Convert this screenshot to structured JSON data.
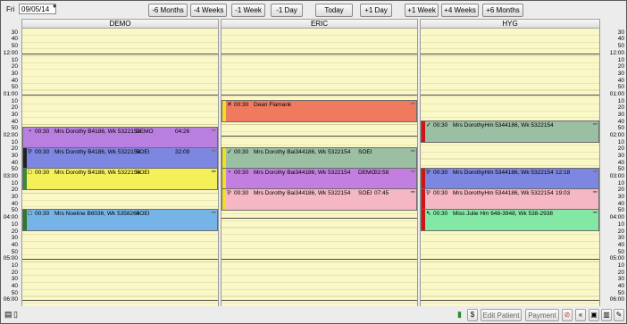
{
  "toolbar": {
    "day": "Fri",
    "date": "09/05/14",
    "buttons": [
      "-6 Months",
      "-4 Weeks",
      "-1 Week",
      "-1 Day",
      "Today",
      "+1 Day",
      "+1 Week",
      "+4 Weeks",
      "+6 Months"
    ]
  },
  "columns": [
    "DEMO",
    "ERIC",
    "HYG"
  ],
  "time_labels": [
    "30",
    "40",
    "50",
    "12:00",
    "10",
    "20",
    "30",
    "40",
    "50",
    "01:00",
    "10",
    "20",
    "30",
    "40",
    "50",
    "02:00",
    "10",
    "20",
    "30",
    "40",
    "50",
    "03:00",
    "10",
    "20",
    "30",
    "40",
    "50",
    "04:00",
    "10",
    "20",
    "30",
    "40",
    "50",
    "05:00",
    "10",
    "20",
    "30",
    "40",
    "50",
    "06:00",
    "10"
  ],
  "appointments": [
    {
      "col": 0,
      "row": 14,
      "time": "00:30",
      "name": "Mrs Dorothy B4186, Wk 5322154",
      "code": "DEMO",
      "dur": "04:26",
      "icon": "◔",
      "bg": "#b97fe0",
      "stripe": "#b97fe0"
    },
    {
      "col": 0,
      "row": 17,
      "time": "00:30",
      "name": "Mrs Dorothy B4186, Wk 5322154",
      "code": "SOEI",
      "dur": "32:09",
      "icon": "⅌",
      "bg": "#7d86e0",
      "stripe": "#222222"
    },
    {
      "col": 0,
      "row": 20,
      "time": "00:30",
      "name": "Mrs Dorothy B4186, Wk 5322154",
      "code": "SOEI",
      "dur": "",
      "icon": "□",
      "bg": "#f5ef5a",
      "stripe": "#3a8a3a"
    },
    {
      "col": 0,
      "row": 26,
      "time": "00:30",
      "name": "Mrs Noeline B6036, Wk 5358264",
      "code": "SOEI",
      "dur": "",
      "icon": "□",
      "bg": "#76b4e8",
      "stripe": "#2a7a2a"
    },
    {
      "col": 1,
      "row": 10,
      "time": "00:30",
      "name": "Dean Flamank",
      "code": "",
      "dur": "",
      "icon": "✕",
      "bg": "#ef7a5e",
      "stripe": "#f0e020"
    },
    {
      "col": 1,
      "row": 17,
      "time": "00:30",
      "name": "Mrs Dorothy Bai344186, Wk 5322154",
      "code": "SOEI",
      "dur": "",
      "icon": "✓",
      "bg": "#9bbfa3",
      "stripe": "#f0e020"
    },
    {
      "col": 1,
      "row": 20,
      "time": "00:30",
      "name": "Mrs Dorothy Bai344186, Wk 5322154",
      "code": "DEMO",
      "dur": "02:58",
      "icon": "◔",
      "bg": "#c37fe0",
      "stripe": "#f0e020"
    },
    {
      "col": 1,
      "row": 23,
      "time": "00:30",
      "name": "Mrs Dorothy Bai344186, Wk 5322154",
      "code": "SOEI",
      "dur": "07:45",
      "icon": "⅌",
      "bg": "#f6b7c4",
      "stripe": "#f0e020"
    },
    {
      "col": 2,
      "row": 13,
      "time": "00:30",
      "name": "Mrs DorothyHm 5344186, Wk 5322154",
      "code": "",
      "dur": "",
      "icon": "✓",
      "bg": "#9bbfa3",
      "stripe": "#cc1515"
    },
    {
      "col": 2,
      "row": 20,
      "time": "00:30",
      "name": "Mrs DorothyHm 5344186, Wk 5322154",
      "code": "",
      "dur": "12:18",
      "icon": "⅌",
      "bg": "#7d86e0",
      "stripe": "#cc1515"
    },
    {
      "col": 2,
      "row": 23,
      "time": "00:30",
      "name": "Mrs DorothyHm 5344186, Wk 5322154",
      "code": "",
      "dur": "19:03",
      "icon": "⅌",
      "bg": "#f6b7c4",
      "stripe": "#cc1515"
    },
    {
      "col": 2,
      "row": 26,
      "time": "00:30",
      "name": "Miss Julie Hm 648-3948, Wk 538-2938",
      "code": "",
      "dur": "",
      "icon": "↖",
      "bg": "#82e8a4",
      "stripe": "#cc1515"
    }
  ],
  "bottom": {
    "edit_patient": "Edit Patient",
    "payment": "Payment",
    "dollar": "$"
  }
}
